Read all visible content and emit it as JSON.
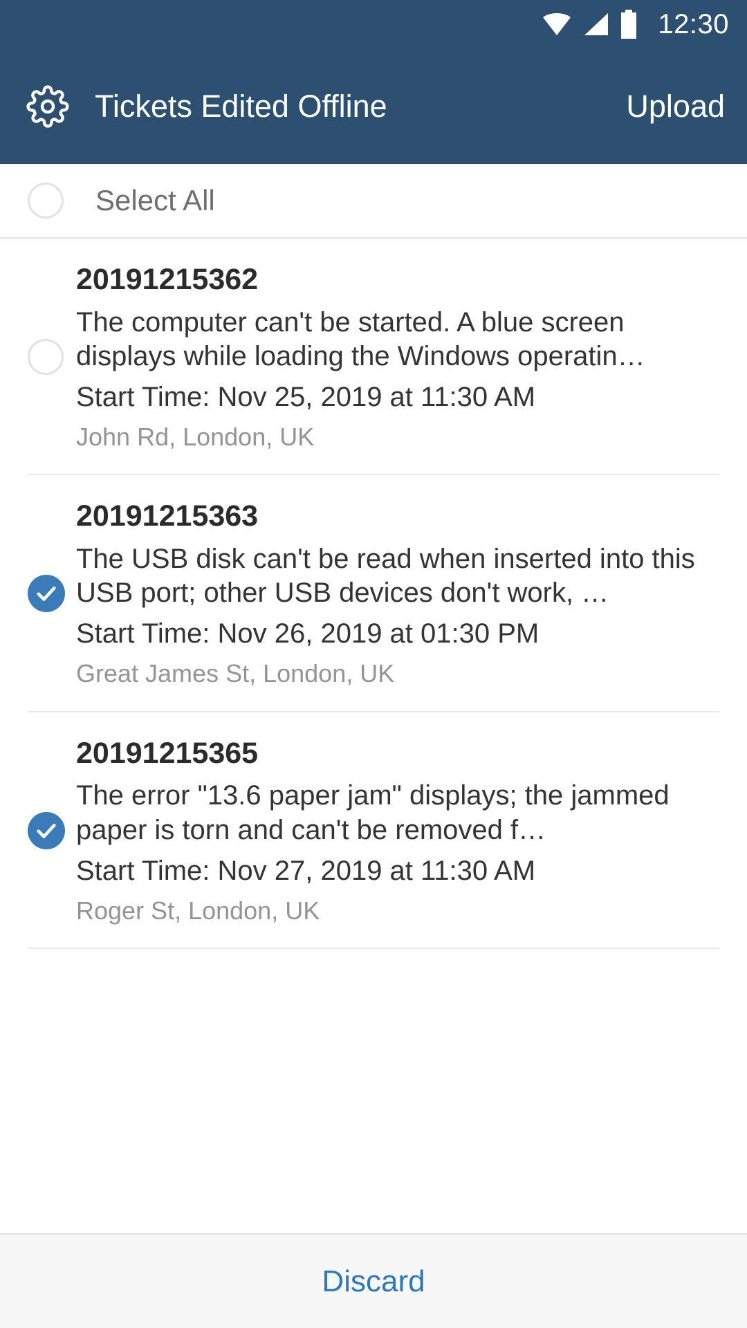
{
  "status_bar": {
    "time": "12:30",
    "icons": [
      "wifi-icon",
      "cellular-signal-icon",
      "battery-icon"
    ]
  },
  "app_bar": {
    "settings_icon": "gear-icon",
    "title": "Tickets Edited Offline",
    "upload_label": "Upload",
    "background_color": "#2d5070",
    "text_color": "#ffffff"
  },
  "select_all": {
    "label": "Select All",
    "checked": false
  },
  "tickets": [
    {
      "id": "20191215362",
      "description": "The computer can't be started. A blue screen displays while loading the Windows operatin…",
      "start_time": "Start Time: Nov 25, 2019 at 11:30 AM",
      "address": "John Rd, London, UK",
      "checked": false
    },
    {
      "id": "20191215363",
      "description": "The USB disk can't be read when inserted into this USB port; other USB devices don't work, …",
      "start_time": "Start Time: Nov 26, 2019 at 01:30 PM",
      "address": "Great James St, London, UK",
      "checked": true
    },
    {
      "id": "20191215365",
      "description": "The error \"13.6 paper jam\" displays; the jammed paper is torn and can't be removed f…",
      "start_time": "Start Time: Nov 27, 2019 at 11:30 AM",
      "address": "Roger St, London, UK",
      "checked": true
    }
  ],
  "bottom_bar": {
    "discard_label": "Discard",
    "discard_color": "#2f79b8"
  },
  "colors": {
    "accent_blue": "#3b7cb8",
    "header_blue": "#2d5070",
    "link_blue": "#2f79b8",
    "muted_gray": "#949494"
  }
}
